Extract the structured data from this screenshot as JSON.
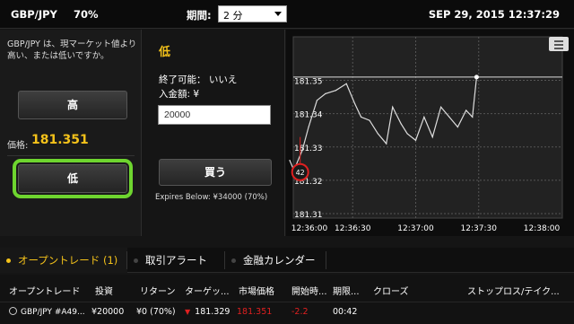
{
  "header": {
    "symbol": "GBP/JPY",
    "percent": "70%",
    "period_label": "期間:",
    "period_value": "2 分",
    "datetime": "SEP 29, 2015 12:37:29"
  },
  "left": {
    "description": "GBP/JPY は、現マーケット値より高い、または低いですか。",
    "high_label": "高",
    "price_label": "価格:",
    "price_value": "181.351",
    "low_label": "低"
  },
  "middle": {
    "title": "低",
    "expiry": "終了可能： いいえ",
    "amount_label": "入金額: ¥",
    "amount_value": "20000",
    "buy_label": "買う",
    "expires_below": "Expires Below: ¥34000 (70%)"
  },
  "chart_data": {
    "type": "line",
    "y_ticks": [
      "181.35",
      "181.34",
      "181.33",
      "181.32",
      "181.31"
    ],
    "x_ticks": [
      "12:36:00",
      "12:36:30",
      "12:37:00",
      "12:37:30",
      "12:38:00"
    ],
    "ylim": [
      181.31,
      181.355
    ],
    "strike_line": 181.351,
    "marker_label": "42",
    "series": [
      {
        "x": [
          "12:36:00",
          "12:36:02",
          "12:36:06",
          "12:36:09",
          "12:36:13",
          "12:36:17",
          "12:36:22",
          "12:36:27",
          "12:36:31",
          "12:36:34",
          "12:36:38",
          "12:36:42",
          "12:36:46",
          "12:36:49",
          "12:36:53",
          "12:36:56",
          "12:37:00",
          "12:37:04",
          "12:37:08",
          "12:37:12",
          "12:37:16",
          "12:37:20",
          "12:37:24",
          "12:37:27",
          "12:37:29"
        ],
        "y": [
          181.326,
          181.323,
          181.329,
          181.336,
          181.344,
          181.346,
          181.347,
          181.349,
          181.343,
          181.339,
          181.338,
          181.334,
          181.331,
          181.342,
          181.337,
          181.334,
          181.332,
          181.339,
          181.333,
          181.342,
          181.339,
          181.336,
          181.341,
          181.339,
          181.351
        ]
      }
    ]
  },
  "tabs": [
    {
      "label": "オープントレード (1)",
      "active": true
    },
    {
      "label": "取引アラート",
      "active": false
    },
    {
      "label": "金融カレンダー",
      "active": false
    }
  ],
  "table": {
    "headers": [
      "オープントレード",
      "投資",
      "リターン",
      "ターゲッ...",
      "市場価格",
      "開始時...",
      "期限...",
      "クローズ",
      "ストップロス/テイク..."
    ],
    "row": {
      "symbol": "GBP/JPY #A49...",
      "investment": "¥20000",
      "return": "¥0 (70%)",
      "target": "181.329",
      "market": "181.351",
      "change": "-2.2",
      "expiry": "00:42"
    }
  },
  "colors": {
    "accent": "#f4c21a",
    "highlight": "#6ed52f",
    "down": "#e02020"
  }
}
